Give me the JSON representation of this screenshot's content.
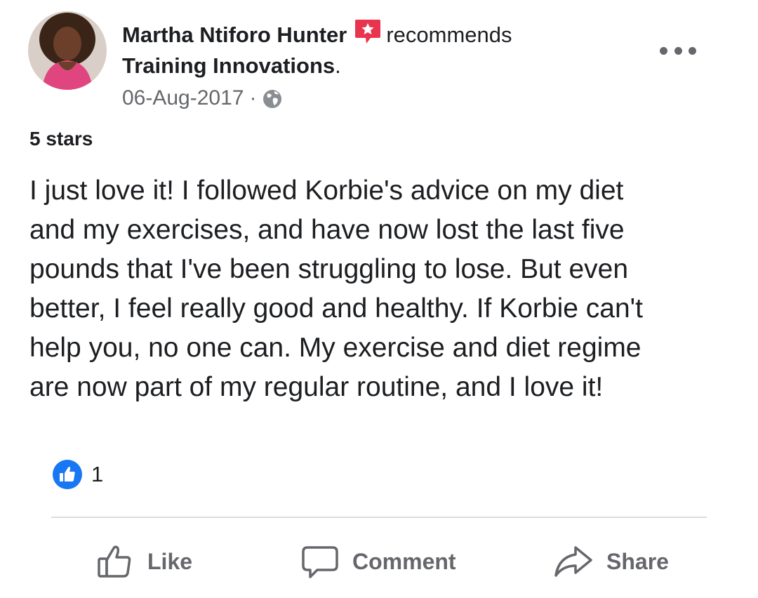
{
  "post": {
    "author": "Martha Ntiforo Hunter",
    "action_text": "recommends",
    "page_name": "Training Innovations",
    "page_suffix": ".",
    "date": "06-Aug-2017",
    "separator": "·",
    "audience_icon": "globe-icon",
    "recommend_icon": "recommend-star-icon",
    "more_icon": "more-dots-icon",
    "rating": "5 stars",
    "body_lines": [
      "I just love it!  I followed Korbie's advice on my diet",
      "and my exercises, and have now lost the last five",
      "pounds that I've been struggling to lose.  But even",
      "better, I feel really good and healthy.  If Korbie can't",
      "help you, no one can.  My exercise and diet regime",
      "are now part of my regular routine, and I love it!"
    ],
    "reaction_count": "1",
    "reaction_icon": "like-reaction-icon"
  },
  "actions": {
    "like_label": "Like",
    "comment_label": "Comment",
    "share_label": "Share"
  },
  "colors": {
    "text": "#1c1e21",
    "secondary": "#65676b",
    "recommend_red": "#e8344e",
    "like_blue": "#1877f2",
    "divider": "#dadde1"
  }
}
